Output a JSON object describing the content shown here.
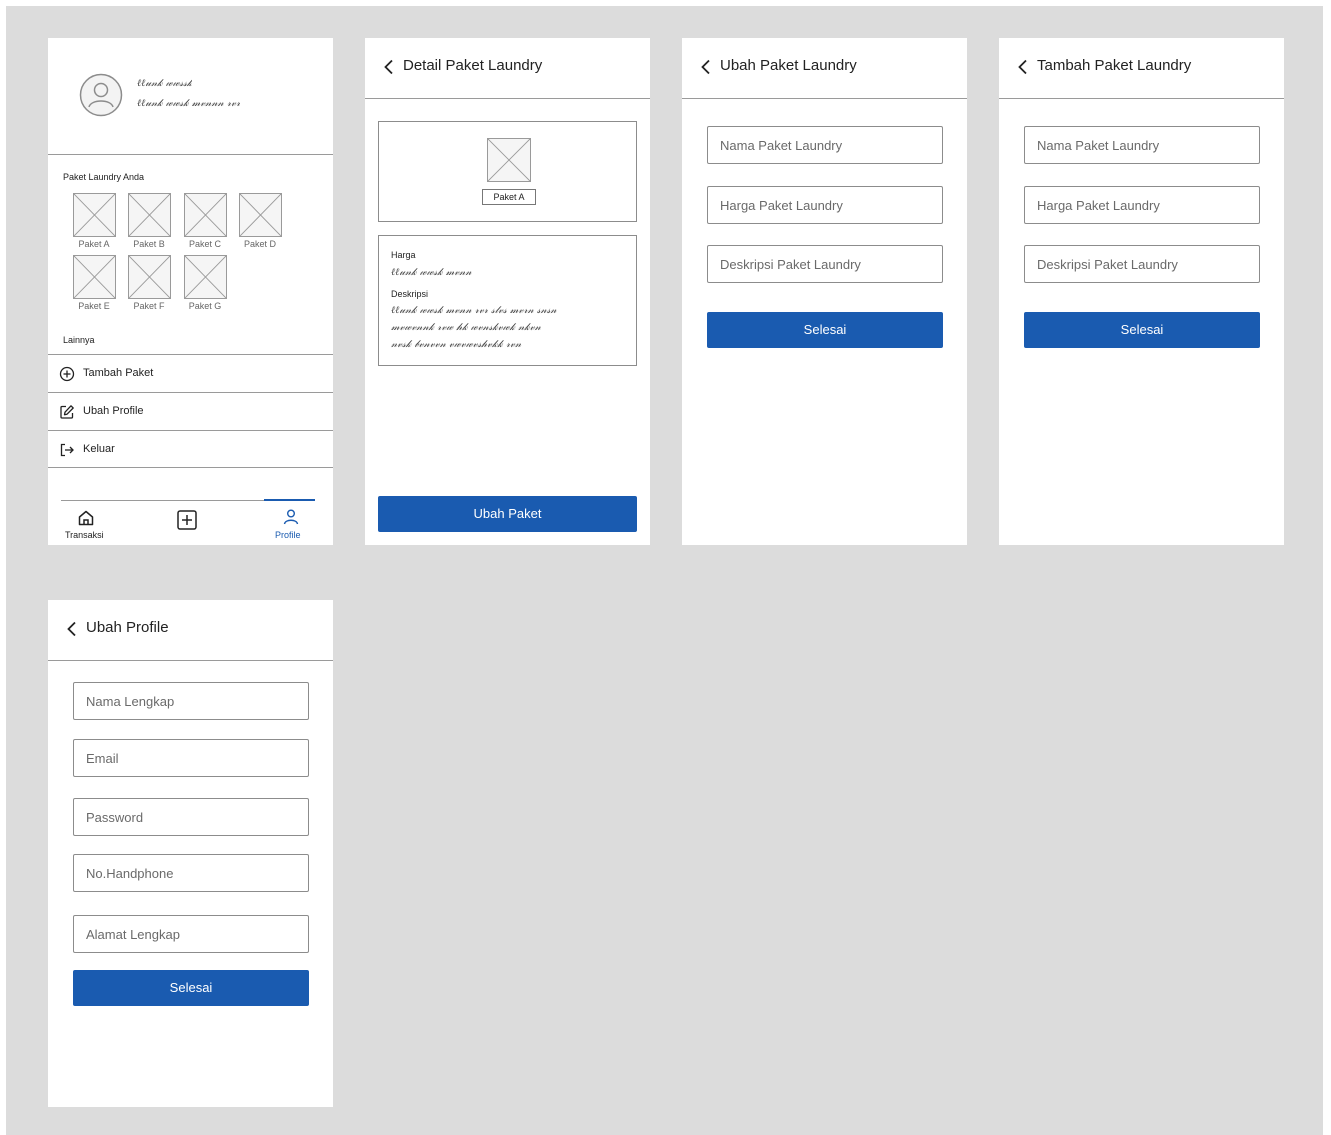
{
  "colors": {
    "background": "#dcdcdc",
    "primary": "#1a5bb0",
    "border": "#8c8c8c"
  },
  "profile_screen": {
    "avatar_icon": "user-avatar-icon",
    "user_name_scribble": "ℓℓ𝓊𝓃𝓀 𝓌𝓌𝓈𝓈𝓀",
    "user_info_scribble": "ℓℓ𝓊𝓃𝓀 𝓌𝓌𝓈𝓀 𝓂𝓋𝓃𝓃𝓃 𝓇𝓋𝓇",
    "packages_title": "Paket Laundry Anda",
    "packages": [
      "Paket A",
      "Paket B",
      "Paket C",
      "Paket D",
      "Paket E",
      "Paket F",
      "Paket G"
    ],
    "more_title": "Lainnya",
    "menu": [
      {
        "label": "Tambah Paket",
        "icon": "plus-circle-icon"
      },
      {
        "label": "Ubah Profile",
        "icon": "edit-icon"
      },
      {
        "label": "Keluar",
        "icon": "logout-icon"
      }
    ],
    "nav": {
      "transaksi_label": "Transaksi",
      "profile_label": "Profile",
      "add_icon": "plus-square-icon"
    }
  },
  "detail_screen": {
    "title": "Detail Paket Laundry",
    "image_caption": "Paket A",
    "price_label": "Harga",
    "price_scribble": "ℓℓ𝓊𝓃𝓀 𝓌𝓌𝓈𝓀 𝓂𝓋𝓃𝓃",
    "desc_label": "Deskripsi",
    "desc_scribble_1": "ℓℓ𝓊𝓃𝓀 𝓌𝓌𝓈𝓀 𝓂𝓋𝓃𝓃 𝓇𝓋𝓇 𝓈𝓁𝓋𝓈 𝓂𝓋𝓇𝓃 𝓈𝓃𝓈𝓃",
    "desc_scribble_2": "𝓂𝓋𝓌𝓋𝓃𝓃𝓀 𝓇𝓋𝓌 𝒽𝓀 𝓌𝓋𝓃𝓈𝓀𝓋𝓌𝓀 𝓃𝓀𝓋𝓃",
    "desc_scribble_3": "𝓃𝓋𝓈𝓀 𝒷𝓋𝓃𝓋𝓋𝓃 𝓋𝓌𝓋𝓌𝓋𝓈𝒽𝓋𝓀𝓀 𝓇𝓋𝓃",
    "button": "Ubah Paket"
  },
  "edit_package_screen": {
    "title": "Ubah Paket Laundry",
    "name_placeholder": "Nama Paket Laundry",
    "price_placeholder": "Harga Paket Laundry",
    "desc_placeholder": "Deskripsi Paket Laundry",
    "button": "Selesai"
  },
  "add_package_screen": {
    "title": "Tambah Paket Laundry",
    "name_placeholder": "Nama Paket Laundry",
    "price_placeholder": "Harga Paket Laundry",
    "desc_placeholder": "Deskripsi Paket Laundry",
    "button": "Selesai"
  },
  "edit_profile_screen": {
    "title": "Ubah Profile",
    "fullname_placeholder": "Nama Lengkap",
    "email_placeholder": "Email",
    "password_placeholder": "Password",
    "phone_placeholder": "No.Handphone",
    "address_placeholder": "Alamat Lengkap",
    "button": "Selesai"
  }
}
